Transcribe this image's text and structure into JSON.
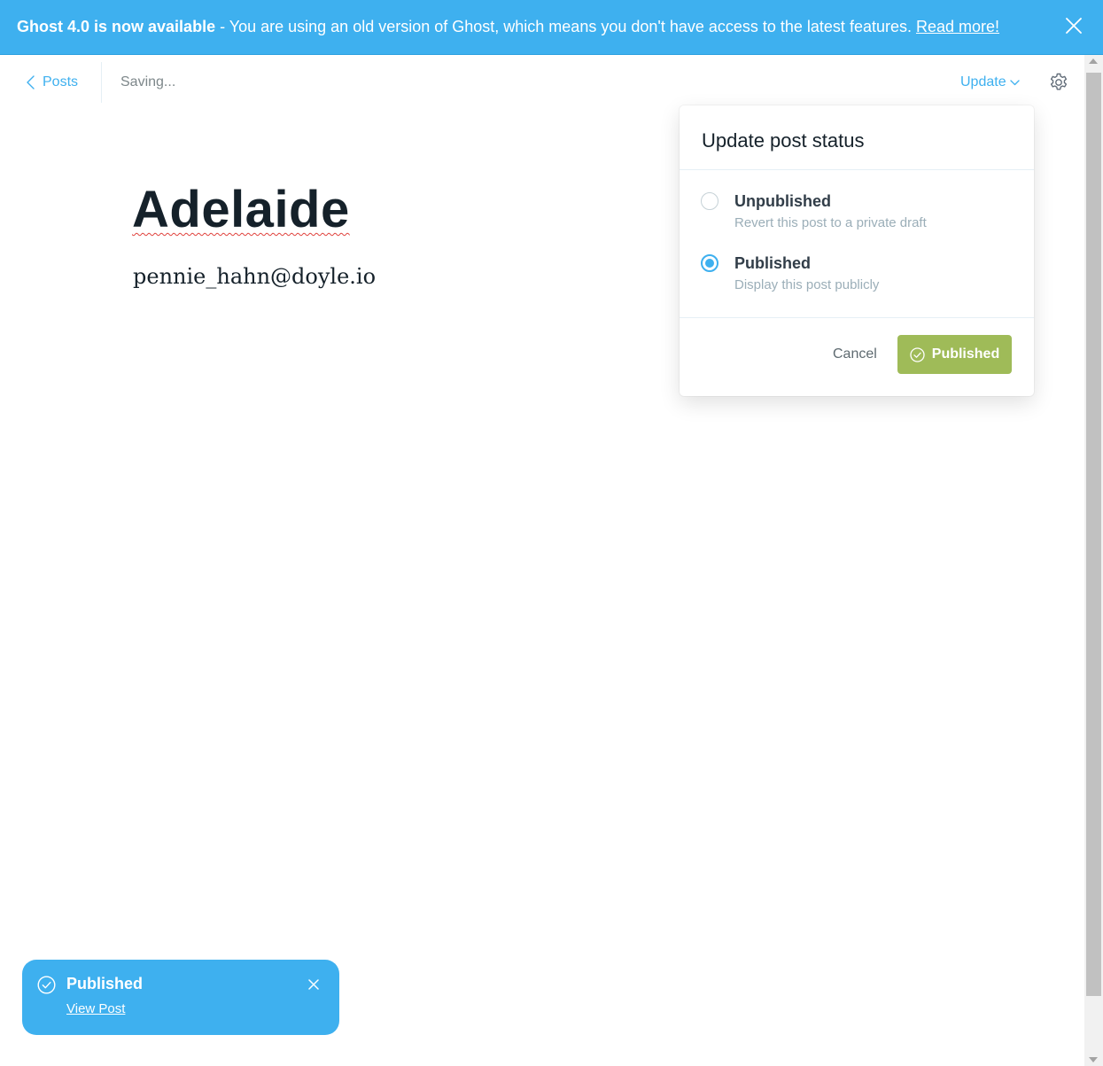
{
  "banner": {
    "bold_text": "Ghost 4.0 is now available",
    "message": " - You are using an old version of Ghost, which means you don't have access to the latest features. ",
    "link_text": "Read more!",
    "close_icon": "close-icon"
  },
  "header": {
    "back_label": "Posts",
    "status_text": "Saving...",
    "update_label": "Update",
    "settings_icon": "gear-icon"
  },
  "post": {
    "title": "Adelaide",
    "body": "pennie_hahn@doyle.io"
  },
  "popover": {
    "title": "Update post status",
    "options": [
      {
        "label": "Unpublished",
        "description": "Revert this post to a private draft",
        "selected": false
      },
      {
        "label": "Published",
        "description": "Display this post publicly",
        "selected": true
      }
    ],
    "cancel_label": "Cancel",
    "confirm_label": "Published"
  },
  "toast": {
    "title": "Published",
    "link_text": "View Post"
  },
  "colors": {
    "accent": "#3eb0ef",
    "publish_green": "#9fbb58",
    "text_dark": "#15212a"
  }
}
